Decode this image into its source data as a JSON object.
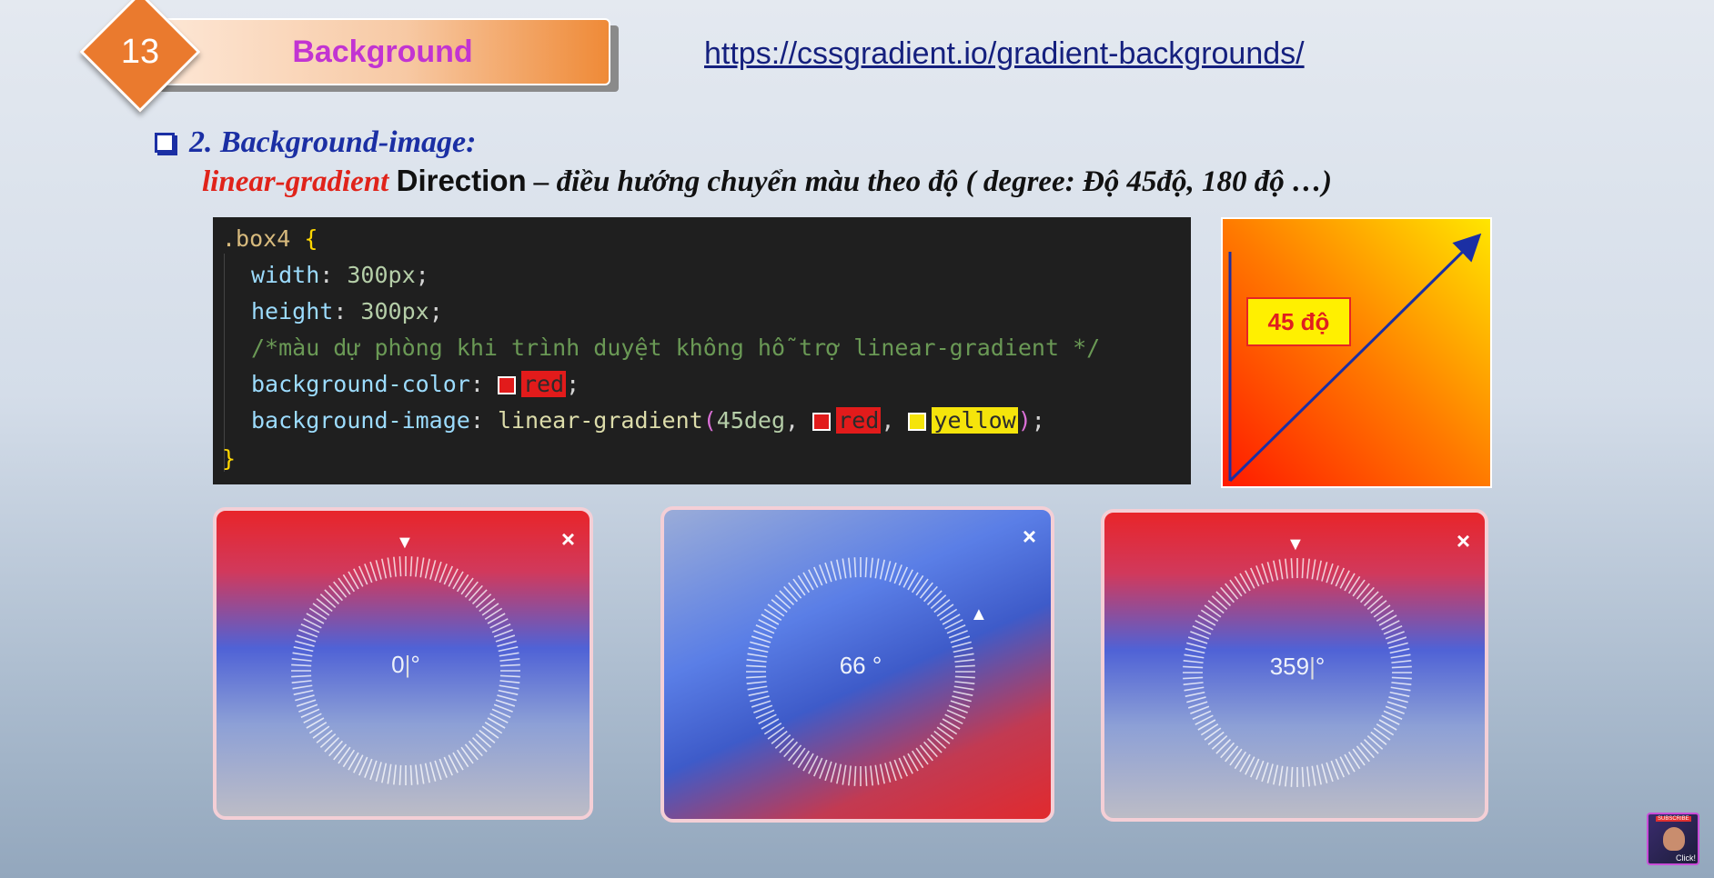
{
  "header": {
    "badge_number": "13",
    "title": "Background",
    "link": "https://cssgradient.io/gradient-backgrounds/"
  },
  "section": {
    "heading": "2. Background-image:",
    "subheading_keyword": "linear-gradient",
    "subheading_direction": "Direction",
    "subheading_rest": " – điều hướng chuyển màu theo độ ( degree: Độ 45độ, 180 độ …)"
  },
  "code": {
    "selector": ".box4",
    "open_brace": "{",
    "close_brace": "}",
    "width_prop": "width",
    "width_val": "300px",
    "height_prop": "height",
    "height_val": "300px",
    "comment": "/*màu dự phòng khi trình duyệt không hỗ trợ linear-gradient */",
    "bgcolor_prop": "background-color",
    "bgcolor_val": "red",
    "bgimage_prop": "background-image",
    "bgimage_fn": "linear-gradient",
    "bgimage_angle": "45deg",
    "bgimage_color1": "red",
    "bgimage_color2": "yellow"
  },
  "gradient_demo": {
    "label": "45 độ",
    "angle_deg": 45,
    "colors": [
      "#ff1a00",
      "#ffe600"
    ]
  },
  "dials": [
    {
      "value": "0",
      "unit": "°",
      "close": "×",
      "angle": 0
    },
    {
      "value": "66",
      "unit": "°",
      "close": "×",
      "angle": 66
    },
    {
      "value": "359",
      "unit": "°",
      "close": "×",
      "angle": 359
    }
  ],
  "thumbnail": {
    "badge": "SUBSCRIBE",
    "caption": "Click!"
  }
}
